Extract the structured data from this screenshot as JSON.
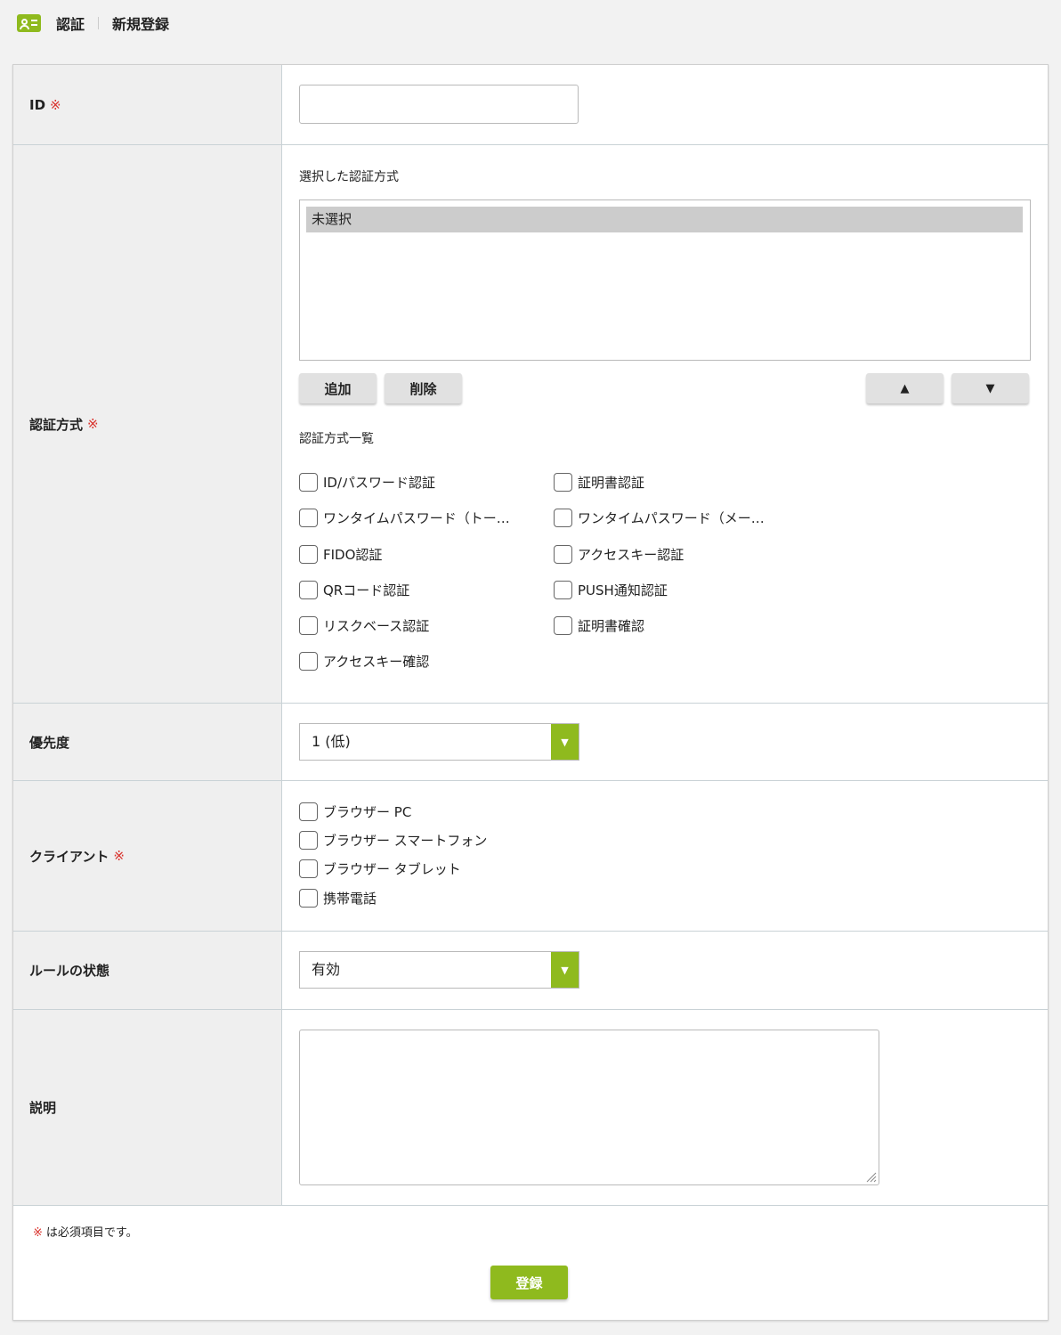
{
  "header": {
    "icon": "user-card-icon",
    "breadcrumb_1": "認証",
    "breadcrumb_2": "新規登録"
  },
  "required_mark": "※",
  "form": {
    "id": {
      "label": "ID",
      "value": ""
    },
    "auth_method": {
      "label": "認証方式",
      "selected_title": "選択した認証方式",
      "selected_items": [
        "未選択"
      ],
      "add_label": "追加",
      "delete_label": "削除",
      "up_label": "▲",
      "down_label": "▼",
      "list_title": "認証方式一覧",
      "options": [
        "ID/パスワード認証",
        "証明書認証",
        "ワンタイムパスワード（トー…",
        "ワンタイムパスワード（メー…",
        "FIDO認証",
        "アクセスキー認証",
        "QRコード認証",
        "PUSH通知認証",
        "リスクベース認証",
        "証明書確認",
        "アクセスキー確認"
      ]
    },
    "priority": {
      "label": "優先度",
      "value": "1 (低)"
    },
    "client": {
      "label": "クライアント",
      "options": [
        "ブラウザー PC",
        "ブラウザー スマートフォン",
        "ブラウザー タブレット",
        "携帯電話"
      ]
    },
    "rule_state": {
      "label": "ルールの状態",
      "value": "有効"
    },
    "description": {
      "label": "説明",
      "value": ""
    }
  },
  "footnote": "は必須項目です。",
  "submit_label": "登録",
  "colors": {
    "accent": "#8fba1e",
    "required": "#d9312b"
  }
}
